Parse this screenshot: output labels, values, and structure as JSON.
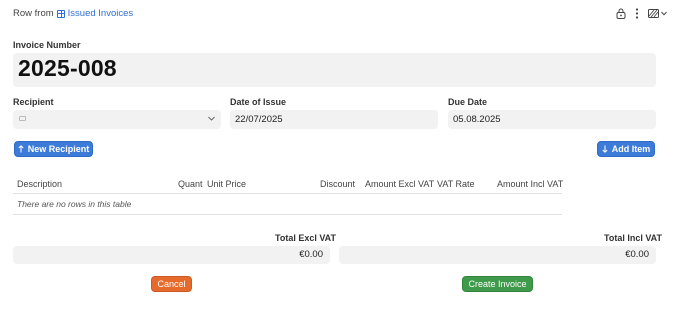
{
  "header": {
    "prefix": "Row from",
    "table_name": "Issued Invoices"
  },
  "icons": {
    "table": "table-icon",
    "lock": "lock-icon",
    "menu": "vertical-dots-icon",
    "view": "pattern-view-icon",
    "caret": "chevron-down-icon",
    "arrow_up": "arrow-up-icon",
    "arrow_down": "arrow-down-icon"
  },
  "invoice": {
    "label": "Invoice Number",
    "value": "2025-008"
  },
  "recipient": {
    "label": "Recipient",
    "value": ""
  },
  "date_of_issue": {
    "label": "Date of Issue",
    "value": "22/07/2025"
  },
  "due_date": {
    "label": "Due Date",
    "value": "05.08.2025"
  },
  "buttons": {
    "new_recipient": "New Recipient",
    "add_item": "Add Item",
    "cancel": "Cancel",
    "create_invoice": "Create Invoice"
  },
  "table": {
    "columns": [
      "Description",
      "Quant",
      "Unit Price",
      "Discount",
      "Amount Excl VAT",
      "VAT Rate",
      "Amount Incl VAT"
    ],
    "empty_message": "There are no rows in this table"
  },
  "totals": {
    "excl_label": "Total Excl VAT",
    "excl_value": "€0.00",
    "incl_label": "Total Incl VAT",
    "incl_value": "€0.00"
  },
  "colors": {
    "link": "#2f6fd6",
    "primary": "#3d7bd9",
    "cancel": "#e56a2c",
    "create": "#3f9a4a",
    "field_bg": "#f2f2f2"
  }
}
